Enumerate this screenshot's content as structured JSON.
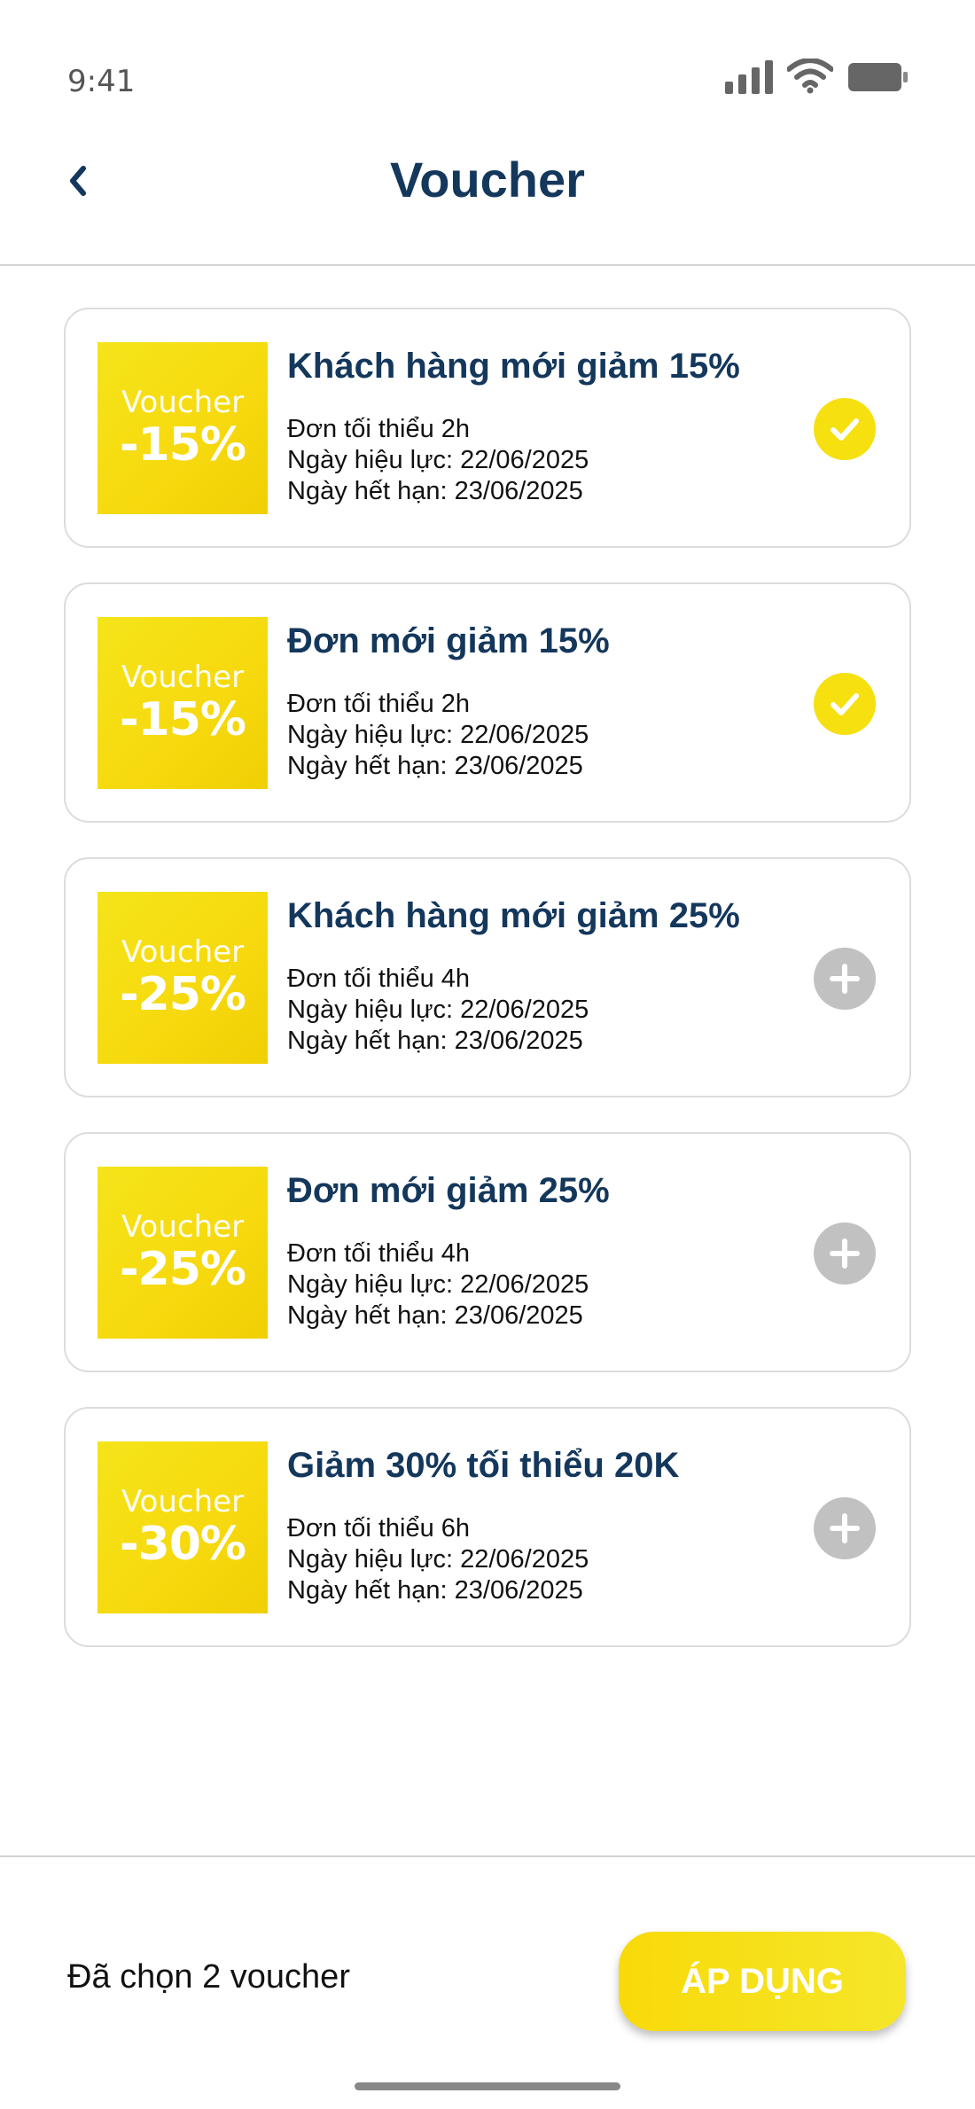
{
  "status_bar": {
    "time": "9:41"
  },
  "header": {
    "title": "Voucher"
  },
  "vouchers": [
    {
      "ticket_word": "Voucher",
      "ticket_percent": "-15%",
      "title": "Khách hàng mới giảm 15%",
      "min_order": "Đơn tối thiểu 2h",
      "valid_from": "Ngày hiệu lực: 22/06/2025",
      "expires": "Ngày hết hạn: 23/06/2025",
      "selected": true
    },
    {
      "ticket_word": "Voucher",
      "ticket_percent": "-15%",
      "title": "Đơn mới giảm 15%",
      "min_order": "Đơn tối thiểu 2h",
      "valid_from": "Ngày hiệu lực: 22/06/2025",
      "expires": "Ngày hết hạn: 23/06/2025",
      "selected": true
    },
    {
      "ticket_word": "Voucher",
      "ticket_percent": "-25%",
      "title": "Khách hàng mới giảm 25%",
      "min_order": "Đơn tối thiểu 4h",
      "valid_from": "Ngày hiệu lực: 22/06/2025",
      "expires": "Ngày hết hạn: 23/06/2025",
      "selected": false
    },
    {
      "ticket_word": "Voucher",
      "ticket_percent": "-25%",
      "title": "Đơn mới giảm 25%",
      "min_order": "Đơn tối thiểu 4h",
      "valid_from": "Ngày hiệu lực: 22/06/2025",
      "expires": "Ngày hết hạn: 23/06/2025",
      "selected": false
    },
    {
      "ticket_word": "Voucher",
      "ticket_percent": "-30%",
      "title": "Giảm 30% tối thiểu 20K",
      "min_order": "Đơn tối thiểu 6h",
      "valid_from": "Ngày hiệu lực: 22/06/2025",
      "expires": "Ngày hết hạn: 23/06/2025",
      "selected": false
    }
  ],
  "footer": {
    "selected_text": "Đã chọn 2 voucher",
    "apply_label": "ÁP DỤNG"
  },
  "colors": {
    "accent": "#f6e00f",
    "title": "#14375c",
    "unselected": "#c1c1c1"
  },
  "icons": {
    "selected": "checkmark-icon",
    "unselected": "plus-icon",
    "back": "chevron-left-icon"
  }
}
